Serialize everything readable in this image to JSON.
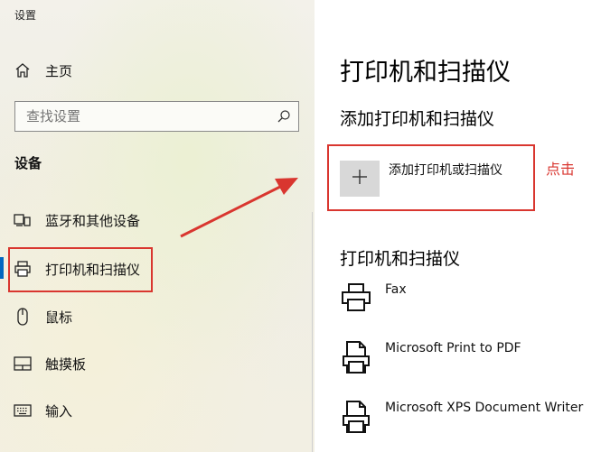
{
  "window": {
    "title": "设置"
  },
  "sidebar": {
    "home_label": "主页",
    "search_placeholder": "查找设置",
    "section_title": "设备",
    "items": [
      {
        "label": "蓝牙和其他设备",
        "icon": "bluetooth-devices-icon"
      },
      {
        "label": "打印机和扫描仪",
        "icon": "printer-icon",
        "selected": true
      },
      {
        "label": "鼠标",
        "icon": "mouse-icon"
      },
      {
        "label": "触摸板",
        "icon": "touchpad-icon"
      },
      {
        "label": "输入",
        "icon": "keyboard-icon"
      }
    ]
  },
  "main": {
    "title": "打印机和扫描仪",
    "add_section_title": "添加打印机和扫描仪",
    "add_button_label": "添加打印机或扫描仪",
    "callout": "点击",
    "list_section_title": "打印机和扫描仪",
    "printers": [
      {
        "name": "Fax",
        "icon": "fax-printer-icon"
      },
      {
        "name": "Microsoft Print to PDF",
        "icon": "pdf-printer-icon"
      },
      {
        "name": "Microsoft XPS Document Writer",
        "icon": "xps-printer-icon"
      }
    ]
  },
  "colors": {
    "highlight": "#d9362f",
    "accent": "#0067c0"
  }
}
